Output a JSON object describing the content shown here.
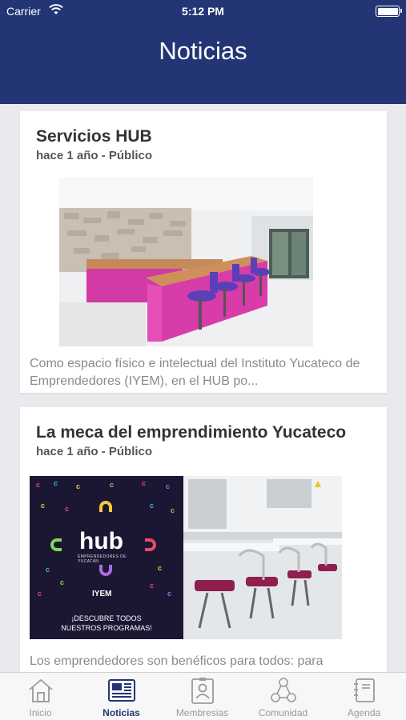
{
  "status_bar": {
    "carrier": "Carrier",
    "time": "5:12 PM"
  },
  "header": {
    "title": "Noticias"
  },
  "posts": [
    {
      "title": "Servicios HUB",
      "meta": "hace 1 año - Público",
      "excerpt": "Como espacio físico e intelectual del Instituto Yucateco de Emprendedores (IYEM), en el HUB po..."
    },
    {
      "title": "La meca del emprendimiento Yucateco",
      "meta": "hace 1 año - Público",
      "excerpt": "Los emprendedores son benéficos para todos: para",
      "image_text": {
        "logo": "hub",
        "logo_sub": "EMPRENDEDORES DE YUCATÁN",
        "brand": "IYEM",
        "cta_line1": "¡DESCUBRE TODOS",
        "cta_line2": "NUESTROS PROGRAMAS!"
      }
    }
  ],
  "tabbar": {
    "active": "Noticias",
    "items": [
      {
        "label": "Inicio",
        "icon": "home-icon"
      },
      {
        "label": "Noticias",
        "icon": "newspaper-icon"
      },
      {
        "label": "Membresias",
        "icon": "badge-icon"
      },
      {
        "label": "Comunidad",
        "icon": "community-icon"
      },
      {
        "label": "Agenda",
        "icon": "notebook-icon"
      }
    ]
  },
  "colors": {
    "nav": "#233574",
    "accent_active": "#233574",
    "inactive": "#9a9a9a",
    "background": "#e9e9ee"
  }
}
